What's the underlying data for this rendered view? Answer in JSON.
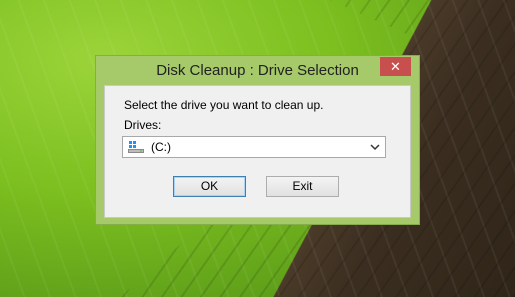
{
  "window": {
    "title": "Disk Cleanup : Drive Selection",
    "close_glyph": "✕"
  },
  "dialog": {
    "prompt": "Select the drive you want to clean up.",
    "drives_label": "Drives:",
    "selected_drive": "(C:)",
    "drive_icon": "windows-drive-icon"
  },
  "buttons": {
    "ok": "OK",
    "exit": "Exit"
  },
  "colors": {
    "frame": "#a6c96a",
    "close": "#c7504e",
    "client": "#f0f0f0"
  }
}
